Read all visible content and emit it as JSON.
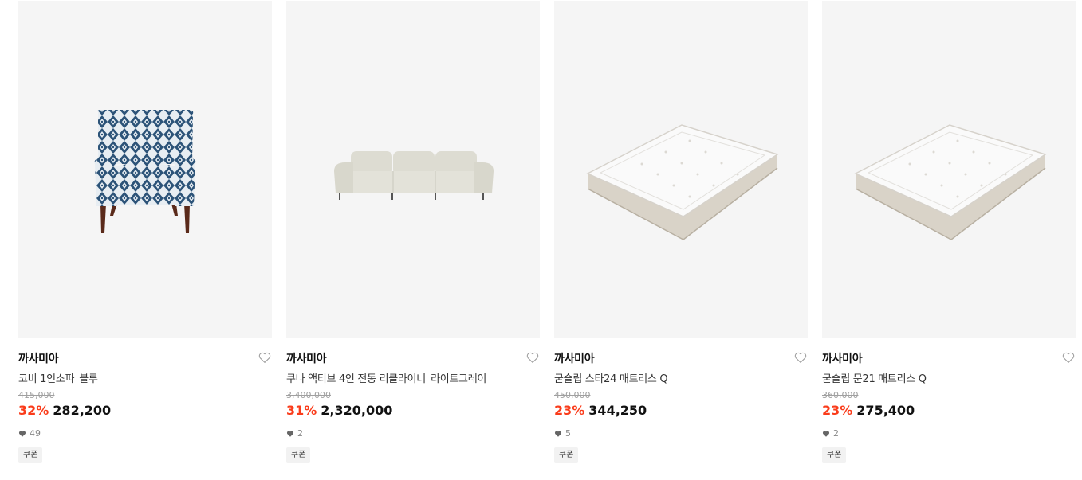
{
  "products": [
    {
      "brand": "까사미아",
      "title": "코비 1인소파_블루",
      "original_price": "415,000",
      "discount": "32%",
      "price": "282,200",
      "likes": "49",
      "coupon": "쿠폰",
      "image_icon": "armchair-icon"
    },
    {
      "brand": "까사미아",
      "title": "쿠나 액티브 4인 전동 리클라이너_라이트그레이",
      "original_price": "3,400,000",
      "discount": "31%",
      "price": "2,320,000",
      "likes": "2",
      "coupon": "쿠폰",
      "image_icon": "sofa-icon"
    },
    {
      "brand": "까사미아",
      "title": "굳슬립 스타24 매트리스 Q",
      "original_price": "450,000",
      "discount": "23%",
      "price": "344,250",
      "likes": "5",
      "coupon": "쿠폰",
      "image_icon": "mattress-icon"
    },
    {
      "brand": "까사미아",
      "title": "굳슬립 문21 매트리스 Q",
      "original_price": "360,000",
      "discount": "23%",
      "price": "275,400",
      "likes": "2",
      "coupon": "쿠폰",
      "image_icon": "mattress-icon"
    }
  ],
  "colors": {
    "discount": "#fa3c1b",
    "thumb_bg": "#f5f5f5",
    "original_price": "#a0a0a0"
  }
}
